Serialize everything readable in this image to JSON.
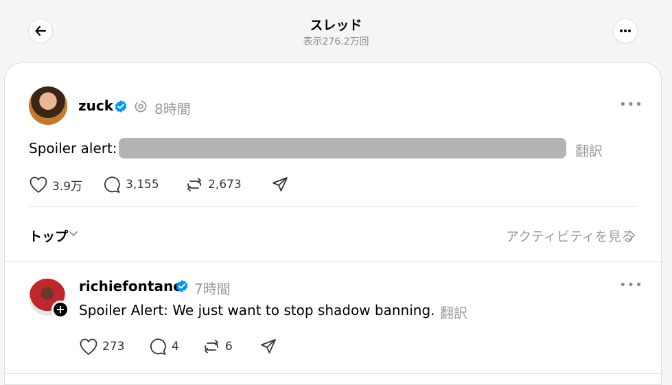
{
  "header": {
    "title": "スレッド",
    "views": "表示276.2万回"
  },
  "post": {
    "username": "zuck",
    "time": "8時間",
    "text_prefix": "Spoiler alert:",
    "translate": "翻訳",
    "likes": "3.9万",
    "comments": "3,155",
    "reposts": "2,673"
  },
  "filter": {
    "label": "トップ",
    "activity_link": "アクティビティを見る"
  },
  "reply": {
    "username": "richiefontane",
    "time": "7時間",
    "text": "Spoiler Alert: We just want to stop shadow banning.",
    "translate": "翻訳",
    "likes": "273",
    "comments": "4",
    "reposts": "6"
  },
  "colors": {
    "verified": "#0095f6",
    "muted": "#9a9a9a",
    "spoiler": "#b4b4b4"
  }
}
